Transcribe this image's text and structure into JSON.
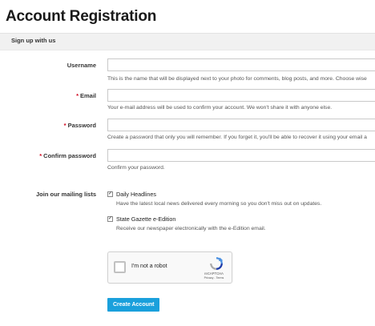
{
  "page": {
    "title": "Account Registration"
  },
  "section": {
    "heading": "Sign up with us"
  },
  "fields": {
    "username": {
      "label": "Username",
      "value": "",
      "help": "This is the name that will be displayed next to your photo for comments, blog posts, and more. Choose wise"
    },
    "email": {
      "required_marker": "*",
      "label": "Email",
      "value": "",
      "help": "Your e-mail address will be used to confirm your account. We won't share it with anyone else."
    },
    "password": {
      "required_marker": "*",
      "label": "Password",
      "value": "",
      "help": "Create a password that only you will remember. If you forget it, you'll be able to recover it using your email a"
    },
    "confirm_password": {
      "required_marker": "*",
      "label": "Confirm password",
      "value": "",
      "help": "Confirm your password."
    }
  },
  "mailing": {
    "label": "Join our mailing lists",
    "options": [
      {
        "checked": true,
        "check_glyph": "✓",
        "title": "Daily Headlines",
        "help": "Have the latest local news delivered every morning so you don't miss out on updates."
      },
      {
        "checked": true,
        "check_glyph": "✓",
        "title": "State Gazette e-Edition",
        "help": "Receive our newspaper electronically with the e-Edition email."
      }
    ]
  },
  "recaptcha": {
    "label": "I'm not a robot",
    "brand": "reCAPTCHA",
    "links": "Privacy - Terms",
    "icon": "recaptcha-logo-icon"
  },
  "submit": {
    "label": "Create Account"
  },
  "colors": {
    "accent": "#1aa0dc",
    "required": "#d0021b",
    "section_bg": "#f1f1f1"
  }
}
